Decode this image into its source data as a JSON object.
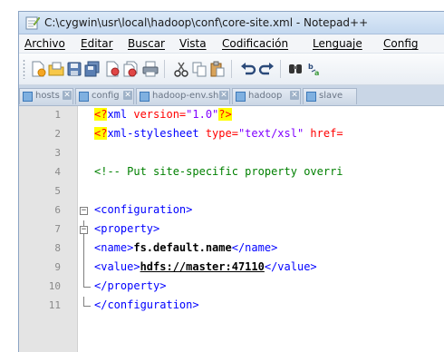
{
  "window": {
    "title": "C:\\cygwin\\usr\\local\\hadoop\\conf\\core-site.xml - Notepad++"
  },
  "menu": {
    "items": [
      "Archivo",
      "Editar",
      "Buscar",
      "Vista",
      "Codificación",
      "Lenguaje",
      "Config"
    ]
  },
  "toolbar": {
    "icons": [
      "new-file-icon",
      "open-file-icon",
      "save-icon",
      "save-all-icon",
      "close-icon",
      "close-all-icon",
      "print-icon",
      "cut-icon",
      "copy-icon",
      "paste-icon",
      "undo-icon",
      "redo-icon",
      "find-icon",
      "replace-icon"
    ]
  },
  "tabs": [
    {
      "label": "hosts"
    },
    {
      "label": "config"
    },
    {
      "label": "hadoop-env.sh"
    },
    {
      "label": "hadoop"
    },
    {
      "label": "slave"
    }
  ],
  "editor": {
    "lines": [
      {
        "n": "1"
      },
      {
        "n": "2"
      },
      {
        "n": "3"
      },
      {
        "n": "4"
      },
      {
        "n": "5"
      },
      {
        "n": "6"
      },
      {
        "n": "7"
      },
      {
        "n": "8"
      },
      {
        "n": "9"
      },
      {
        "n": "10"
      },
      {
        "n": "11"
      }
    ],
    "l1": {
      "pi_open": "<?",
      "name": "xml ",
      "attr": "version=",
      "val": "\"1.0\"",
      "pi_close": "?>"
    },
    "l2": {
      "pi_open": "<?",
      "name": "xml-stylesheet ",
      "attr1": "type=",
      "val1": "\"text/xsl\"",
      "attr2": " href="
    },
    "l4": {
      "comment": "<!-- Put site-specific property overri"
    },
    "l6": {
      "tag": "<configuration>"
    },
    "l7": {
      "tag": "<property>"
    },
    "l8": {
      "open": "<name>",
      "text": "fs.default.name",
      "close": "</name>"
    },
    "l9": {
      "open": "<value>",
      "text": "hdfs://master:47110",
      "close": "</value>"
    },
    "l10": {
      "tag": "</property>"
    },
    "l11": {
      "tag": "</configuration>"
    }
  },
  "colors": {
    "tag": "#0000ff",
    "attribute": "#ff0000",
    "string": "#8000ff",
    "comment": "#008000",
    "highlight": "#ffff00"
  }
}
